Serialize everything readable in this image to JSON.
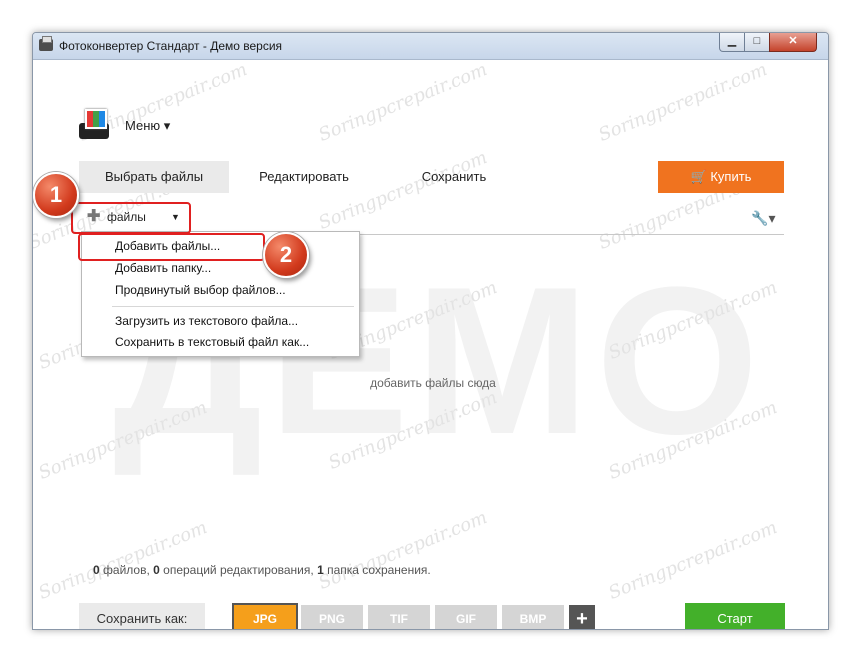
{
  "window": {
    "title": "Фотоконвертер Стандарт - Демо версия",
    "controls": {
      "minimize": "▁",
      "maximize": "□",
      "close": "✕"
    }
  },
  "header": {
    "menu_label": "Меню ▾"
  },
  "tabs": [
    {
      "label": "Выбрать файлы",
      "active": true
    },
    {
      "label": "Редактировать",
      "active": false
    },
    {
      "label": "Сохранить",
      "active": false
    }
  ],
  "buy_button": {
    "label": "Купить",
    "icon": "cart-icon",
    "color": "#f0731f"
  },
  "files_button": {
    "label": "файлы",
    "icon": "plus-icon",
    "caret": "▼"
  },
  "tools_icon": {
    "label": "▾",
    "icon": "wrench-icon"
  },
  "context_menu": {
    "items": [
      "Добавить файлы...",
      "Добавить папку...",
      "Продвинутый выбор файлов...",
      "Загрузить из текстового файла...",
      "Сохранить в текстовый файл как..."
    ]
  },
  "drop_hint": "добавить файлы сюда",
  "watermark": {
    "big": "ДЕМО",
    "small": "Soringpcrepair.com"
  },
  "status": {
    "files_count": "0",
    "files_text": " файлов, ",
    "ops_count": "0",
    "ops_text": " операций редактирования, ",
    "folders_count": "1",
    "folders_text": " папка сохранения."
  },
  "save_bar": {
    "label": "Сохранить как:",
    "formats": [
      {
        "label": "JPG",
        "active": true
      },
      {
        "label": "PNG",
        "active": false
      },
      {
        "label": "TIF",
        "active": false
      },
      {
        "label": "GIF",
        "active": false
      },
      {
        "label": "BMP",
        "active": false
      }
    ],
    "add_label": "+",
    "start_label": "Старт"
  },
  "annotations": {
    "step1": "1",
    "step2": "2"
  },
  "colors": {
    "accent_orange": "#f0731f",
    "start_green": "#43b02a",
    "jpg_active": "#f59f1b",
    "callout_red": "#e02020"
  }
}
